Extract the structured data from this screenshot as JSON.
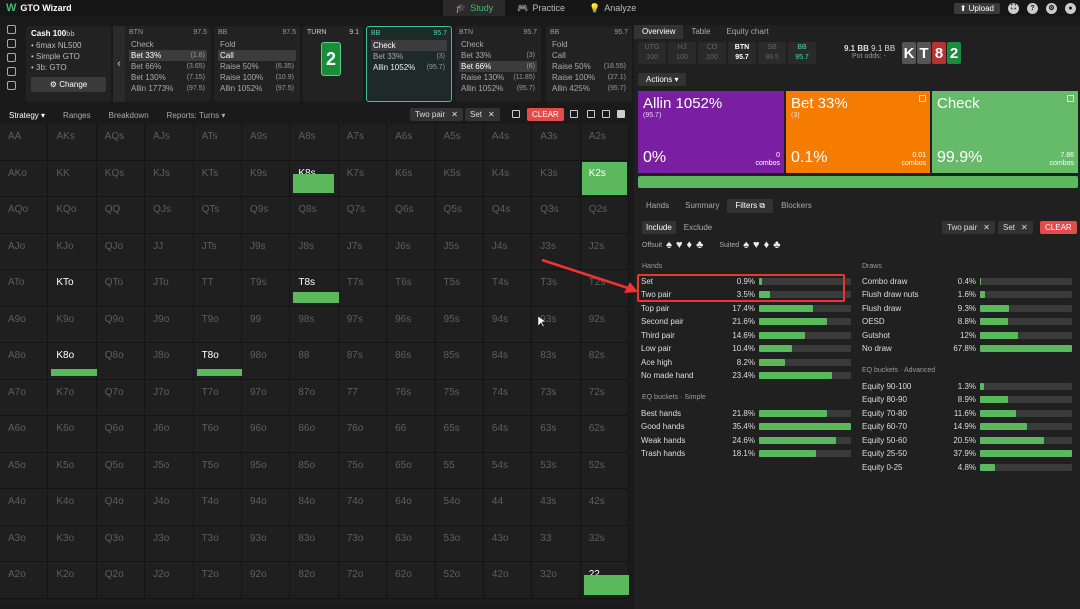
{
  "app": {
    "logo": "W",
    "name": "GTO Wizard"
  },
  "nav": [
    {
      "label": "Study",
      "icon": "graduation-cap-icon",
      "active": true
    },
    {
      "label": "Practice",
      "icon": "gamepad-icon",
      "active": false
    },
    {
      "label": "Analyze",
      "icon": "bulb-icon",
      "active": false
    }
  ],
  "top": {
    "upload": "Upload"
  },
  "game": {
    "title": "Cash",
    "stack": "100",
    "stack_unit": "bb",
    "items": [
      "6max NL500",
      "Simple GTO",
      "3b: GTO"
    ],
    "change": "Change"
  },
  "positions": [
    {
      "name": "BTN",
      "stack": "97.5",
      "actions": [
        {
          "label": "Check",
          "size": ""
        },
        {
          "label": "Bet 33%",
          "size": "(1.8)",
          "sel": true
        },
        {
          "label": "Bet 66%",
          "size": "(3.65)"
        },
        {
          "label": "Bet 130%",
          "size": "(7.15)"
        },
        {
          "label": "Allin 1773%",
          "size": "(97.5)"
        }
      ]
    },
    {
      "name": "BB",
      "stack": "97.5",
      "actions": [
        {
          "label": "Fold",
          "size": ""
        },
        {
          "label": "Call",
          "size": "",
          "sel": true
        },
        {
          "label": "Raise 50%",
          "size": "(6.35)"
        },
        {
          "label": "Raise 100%",
          "size": "(10.9)"
        },
        {
          "label": "Allin 1052%",
          "size": "(97.5)"
        }
      ]
    },
    {
      "name": "BB",
      "stack": "95.7",
      "active": true,
      "actions": [
        {
          "label": "Check",
          "size": "",
          "sel": true
        },
        {
          "label": "Bet 33%",
          "size": "(3)"
        },
        {
          "label": "Allin 1052%",
          "size": "(95.7)",
          "main": true
        }
      ]
    },
    {
      "name": "BTN",
      "stack": "95.7",
      "actions": [
        {
          "label": "Check",
          "size": ""
        },
        {
          "label": "Bet 33%",
          "size": "(3)"
        },
        {
          "label": "Bet 66%",
          "size": "(6)",
          "sel": true
        },
        {
          "label": "Raise 130%",
          "size": "(11.85)"
        },
        {
          "label": "Allin 1052%",
          "size": "(95.7)"
        }
      ]
    },
    {
      "name": "BB",
      "stack": "95.7",
      "actions": [
        {
          "label": "Fold",
          "size": ""
        },
        {
          "label": "Call",
          "size": ""
        },
        {
          "label": "Raise 50%",
          "size": "(18.55)"
        },
        {
          "label": "Raise 100%",
          "size": "(27.1)"
        },
        {
          "label": "Allin 425%",
          "size": "(95.7)"
        }
      ]
    }
  ],
  "turn": {
    "label": "TURN",
    "pot": "9.1",
    "card": "2"
  },
  "grid_tabs": [
    {
      "label": "Strategy",
      "active": true
    },
    {
      "label": "Ranges"
    },
    {
      "label": "Breakdown"
    },
    {
      "label": "Reports: Turns"
    }
  ],
  "grid_filters": {
    "chips": [
      "Two pair",
      "Set"
    ],
    "clear": "CLEAR"
  },
  "grid": {
    "rows": [
      [
        "AA",
        "AKs",
        "AQs",
        "AJs",
        "ATs",
        "A9s",
        "A8s",
        "A7s",
        "A6s",
        "A5s",
        "A4s",
        "A3s",
        "A2s"
      ],
      [
        "AKo",
        "KK",
        "KQs",
        "KJs",
        "KTs",
        "K9s",
        "K8s",
        "K7s",
        "K6s",
        "K5s",
        "K4s",
        "K3s",
        "K2s"
      ],
      [
        "AQo",
        "KQo",
        "QQ",
        "QJs",
        "QTs",
        "Q9s",
        "Q8s",
        "Q7s",
        "Q6s",
        "Q5s",
        "Q4s",
        "Q3s",
        "Q2s"
      ],
      [
        "AJo",
        "KJo",
        "QJo",
        "JJ",
        "JTs",
        "J9s",
        "J8s",
        "J7s",
        "J6s",
        "J5s",
        "J4s",
        "J3s",
        "J2s"
      ],
      [
        "ATo",
        "KTo",
        "QTo",
        "JTo",
        "TT",
        "T9s",
        "T8s",
        "T7s",
        "T6s",
        "T5s",
        "T4s",
        "T3s",
        "T2s"
      ],
      [
        "A9o",
        "K9o",
        "Q9o",
        "J9o",
        "T9o",
        "99",
        "98s",
        "97s",
        "96s",
        "95s",
        "94s",
        "93s",
        "92s"
      ],
      [
        "A8o",
        "K8o",
        "Q8o",
        "J8o",
        "T8o",
        "98o",
        "88",
        "87s",
        "86s",
        "85s",
        "84s",
        "83s",
        "82s"
      ],
      [
        "A7o",
        "K7o",
        "Q7o",
        "J7o",
        "T7o",
        "97o",
        "87o",
        "77",
        "76s",
        "75s",
        "74s",
        "73s",
        "72s"
      ],
      [
        "A6o",
        "K6o",
        "Q6o",
        "J6o",
        "T6o",
        "96o",
        "86o",
        "76o",
        "66",
        "65s",
        "64s",
        "63s",
        "62s"
      ],
      [
        "A5o",
        "K5o",
        "Q5o",
        "J5o",
        "T5o",
        "95o",
        "85o",
        "75o",
        "65o",
        "55",
        "54s",
        "53s",
        "52s"
      ],
      [
        "A4o",
        "K4o",
        "Q4o",
        "J4o",
        "T4o",
        "94o",
        "84o",
        "74o",
        "64o",
        "54o",
        "44",
        "43s",
        "42s"
      ],
      [
        "A3o",
        "K3o",
        "Q3o",
        "J3o",
        "T3o",
        "93o",
        "83o",
        "73o",
        "63o",
        "53o",
        "43o",
        "33",
        "32s"
      ],
      [
        "A2o",
        "K2o",
        "Q2o",
        "J2o",
        "T2o",
        "92o",
        "82o",
        "72o",
        "62o",
        "52o",
        "42o",
        "32o",
        "22"
      ]
    ],
    "highlighted": [
      {
        "hand": "K8s",
        "check_share": 0.9,
        "style": "bar"
      },
      {
        "hand": "K2s",
        "check_share": 1.0,
        "style": "full"
      },
      {
        "hand": "KTo",
        "check_share": 0,
        "style": "label"
      },
      {
        "hand": "T8s",
        "check_share": 1.0,
        "style": "bar"
      },
      {
        "hand": "K8o",
        "check_share": 1.0,
        "style": "bar"
      },
      {
        "hand": "T8o",
        "check_share": 1.0,
        "style": "bar"
      },
      {
        "hand": "22",
        "check_share": 1.0,
        "style": "bar"
      }
    ]
  },
  "right": {
    "tabs": [
      {
        "label": "Overview",
        "active": true
      },
      {
        "label": "Table"
      },
      {
        "label": "Equity chart"
      }
    ],
    "posrow": [
      {
        "pos": "UTG",
        "val": "100"
      },
      {
        "pos": "HJ",
        "val": "100"
      },
      {
        "pos": "CO",
        "val": "100"
      },
      {
        "pos": "BTN",
        "val": "95.7",
        "on": true
      },
      {
        "pos": "SB",
        "val": "99.5"
      },
      {
        "pos": "BB",
        "val": "95.7",
        "bb": true
      }
    ],
    "pot": {
      "value": "9.1 BB",
      "sub": "9.1 BB",
      "odds": "Pot odds: -"
    },
    "board": [
      {
        "card": "K",
        "color": "#555"
      },
      {
        "card": "T",
        "color": "#555"
      },
      {
        "card": "8",
        "color": "#b83232"
      },
      {
        "card": "2",
        "color": "#1c8c3c"
      }
    ],
    "actions_btn": "Actions",
    "action_boxes": [
      {
        "title": "Allin 1052%",
        "sub": "(95.7)",
        "pct": "0%",
        "combos": "0",
        "combos_label": "combos",
        "color": "#7b1fa2"
      },
      {
        "title": "Bet 33%",
        "sub": "(3)",
        "pct": "0.1%",
        "combos": "0.01",
        "combos_label": "combos",
        "color": "#f57c00"
      },
      {
        "title": "Check",
        "sub": "",
        "pct": "99.9%",
        "combos": "7.86",
        "combos_label": "combos",
        "color": "#66bb6a"
      }
    ],
    "subtabs": [
      {
        "label": "Hands"
      },
      {
        "label": "Summary"
      },
      {
        "label": "Filters",
        "active": true
      },
      {
        "label": "Blockers"
      }
    ],
    "include": "Include",
    "exclude": "Exclude",
    "offsuit": "Offsuit",
    "suited": "Suited",
    "suits": [
      "♠",
      "♥",
      "♦",
      "♣"
    ],
    "chips": [
      "Two pair",
      "Set"
    ],
    "clear": "CLEAR",
    "hands_title": "Hands",
    "hands": [
      {
        "name": "Set",
        "pct": "0.9%",
        "v": 0.9
      },
      {
        "name": "Two pair",
        "pct": "3.5%",
        "v": 3.5
      },
      {
        "name": "Top pair",
        "pct": "17.4%",
        "v": 17.4
      },
      {
        "name": "Second pair",
        "pct": "21.6%",
        "v": 21.6
      },
      {
        "name": "Third pair",
        "pct": "14.6%",
        "v": 14.6
      },
      {
        "name": "Low pair",
        "pct": "10.4%",
        "v": 10.4
      },
      {
        "name": "Ace high",
        "pct": "8.2%",
        "v": 8.2
      },
      {
        "name": "No made hand",
        "pct": "23.4%",
        "v": 23.4
      }
    ],
    "eq_simple_title": "EQ buckets · Simple",
    "eq_simple": [
      {
        "name": "Best hands",
        "pct": "21.8%",
        "v": 21.8
      },
      {
        "name": "Good hands",
        "pct": "35.4%",
        "v": 35.4
      },
      {
        "name": "Weak hands",
        "pct": "24.6%",
        "v": 24.6
      },
      {
        "name": "Trash hands",
        "pct": "18.1%",
        "v": 18.1
      }
    ],
    "draws_title": "Draws",
    "draws": [
      {
        "name": "Combo draw",
        "pct": "0.4%",
        "v": 0.4
      },
      {
        "name": "Flush draw nuts",
        "pct": "1.6%",
        "v": 1.6
      },
      {
        "name": "Flush draw",
        "pct": "9.3%",
        "v": 9.3
      },
      {
        "name": "OESD",
        "pct": "8.8%",
        "v": 8.8
      },
      {
        "name": "Gutshot",
        "pct": "12%",
        "v": 12
      },
      {
        "name": "No draw",
        "pct": "67.8%",
        "v": 67.8
      }
    ],
    "eq_adv_title": "EQ buckets · Advanced",
    "eq_adv": [
      {
        "name": "Equity 90-100",
        "pct": "1.3%",
        "v": 1.3
      },
      {
        "name": "Equity 80-90",
        "pct": "8.9%",
        "v": 8.9
      },
      {
        "name": "Equity 70-80",
        "pct": "11.6%",
        "v": 11.6
      },
      {
        "name": "Equity 60-70",
        "pct": "14.9%",
        "v": 14.9
      },
      {
        "name": "Equity 50-60",
        "pct": "20.5%",
        "v": 20.5
      },
      {
        "name": "Equity 25-50",
        "pct": "37.9%",
        "v": 37.9
      },
      {
        "name": "Equity 0-25",
        "pct": "4.8%",
        "v": 4.8
      }
    ]
  }
}
